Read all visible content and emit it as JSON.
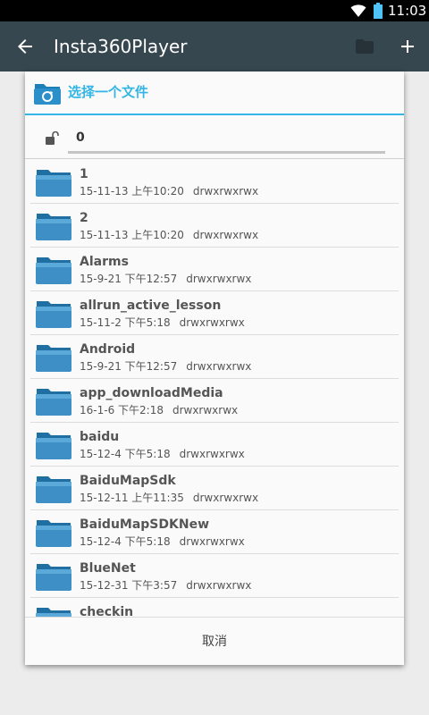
{
  "status_bar": {
    "time": "11:03"
  },
  "app_bar": {
    "title": "Insta360Player"
  },
  "dialog": {
    "title": "选择一个文件",
    "path_value": "0",
    "cancel_label": "取消",
    "files": [
      {
        "name": "1",
        "date": "15-11-13 上午10:20",
        "perms": "drwxrwxrwx"
      },
      {
        "name": "2",
        "date": "15-11-13 上午10:20",
        "perms": "drwxrwxrwx"
      },
      {
        "name": "Alarms",
        "date": "15-9-21 下午12:57",
        "perms": "drwxrwxrwx"
      },
      {
        "name": "allrun_active_lesson",
        "date": "15-11-2 下午5:18",
        "perms": "drwxrwxrwx"
      },
      {
        "name": "Android",
        "date": "15-9-21 下午12:57",
        "perms": "drwxrwxrwx"
      },
      {
        "name": "app_downloadMedia",
        "date": "16-1-6 下午2:18",
        "perms": "drwxrwxrwx"
      },
      {
        "name": "baidu",
        "date": "15-12-4 下午5:18",
        "perms": "drwxrwxrwx"
      },
      {
        "name": "BaiduMapSdk",
        "date": "15-12-11 上午11:35",
        "perms": "drwxrwxrwx"
      },
      {
        "name": "BaiduMapSDKNew",
        "date": "15-12-4 下午5:18",
        "perms": "drwxrwxrwx"
      },
      {
        "name": "BlueNet",
        "date": "15-12-31 下午3:57",
        "perms": "drwxrwxrwx"
      },
      {
        "name": "checkin",
        "date": "",
        "perms": ""
      }
    ]
  },
  "colors": {
    "accent": "#33b5e5",
    "app_bar": "#37474f",
    "folder": "#3d8fc6"
  }
}
